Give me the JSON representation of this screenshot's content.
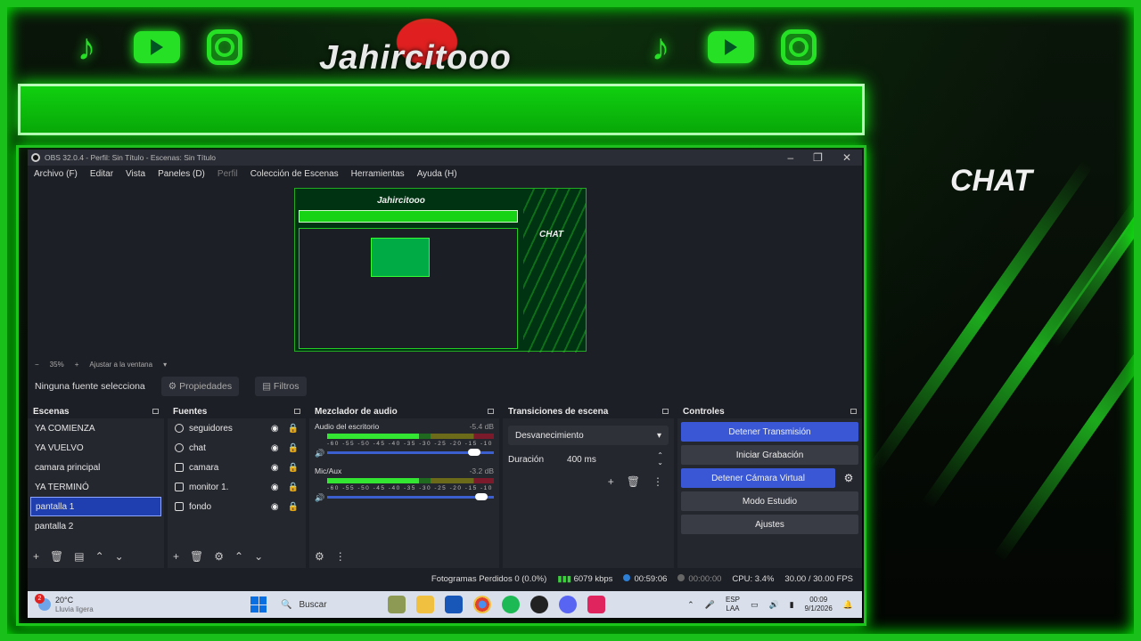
{
  "overlay": {
    "brand_name": "Jahircitooo",
    "chat_label": "CHAT",
    "accent_color": "#19c019",
    "social_icons": [
      "tiktok-icon",
      "youtube-icon",
      "instagram-icon"
    ]
  },
  "obs": {
    "title": "OBS 32.0.4 - Perfil: Sin Título - Escenas: Sin Título",
    "menu": [
      "Archivo (F)",
      "Editar",
      "Vista",
      "Paneles (D)",
      "Perfil",
      "Colección de Escenas",
      "Herramientas",
      "Ayuda (H)"
    ],
    "preview": {
      "brand_name": "Jahircitooo",
      "chat_label": "CHAT"
    },
    "zoom": {
      "minus": "−",
      "value": "35%",
      "plus": "+",
      "fit_label": "Ajustar a la ventana"
    },
    "source_bar": {
      "no_source": "Ninguna fuente selecciona",
      "properties": "Propiedades",
      "filters": "Filtros"
    },
    "scenes": {
      "title": "Escenas",
      "items": [
        "YA COMIENZA",
        "YA VUELVO",
        "camara principal",
        "YA TERMINÓ",
        "pantalla 1",
        "pantalla 2"
      ],
      "selected_index": 4
    },
    "sources": {
      "title": "Fuentes",
      "items": [
        {
          "name": "seguidores",
          "icon": "browser-icon"
        },
        {
          "name": "chat",
          "icon": "browser-icon"
        },
        {
          "name": "camara",
          "icon": "camera-icon"
        },
        {
          "name": "monitor 1.",
          "icon": "monitor-icon"
        },
        {
          "name": "fondo",
          "icon": "image-icon"
        }
      ]
    },
    "mixer": {
      "title": "Mezclador de audio",
      "channels": [
        {
          "name": "Audio del escritorio",
          "db": "-5.4 dB",
          "volume": 0.92
        },
        {
          "name": "Mic/Aux",
          "db": "-3.2 dB",
          "volume": 0.96
        }
      ],
      "scale": "-60  -55  -50  -45  -40  -35  -30  -25  -20  -15  -10   -5   0"
    },
    "transitions": {
      "title": "Transiciones de escena",
      "selected": "Desvanecimiento",
      "duration_label": "Duración",
      "duration_value": "400 ms"
    },
    "controls": {
      "title": "Controles",
      "buttons": {
        "stop_stream": "Detener Transmisión",
        "start_record": "Iniciar Grabación",
        "stop_vcam": "Detener Cámara Virtual",
        "studio_mode": "Modo Estudio",
        "settings": "Ajustes"
      }
    },
    "status": {
      "dropped": "Fotogramas Perdidos 0 (0.0%)",
      "bitrate": "6079 kbps",
      "stream_time": "00:59:06",
      "record_time": "00:00:00",
      "cpu": "CPU: 3.4%",
      "fps": "30.00 / 30.00 FPS"
    }
  },
  "taskbar": {
    "weather_badge": "2",
    "temp": "20°C",
    "weather_desc": "Lluvia ligera",
    "search": "Buscar",
    "lang": "ESP",
    "lang_sub": "LAA",
    "time": "00:09",
    "date": "9/1/2026"
  }
}
